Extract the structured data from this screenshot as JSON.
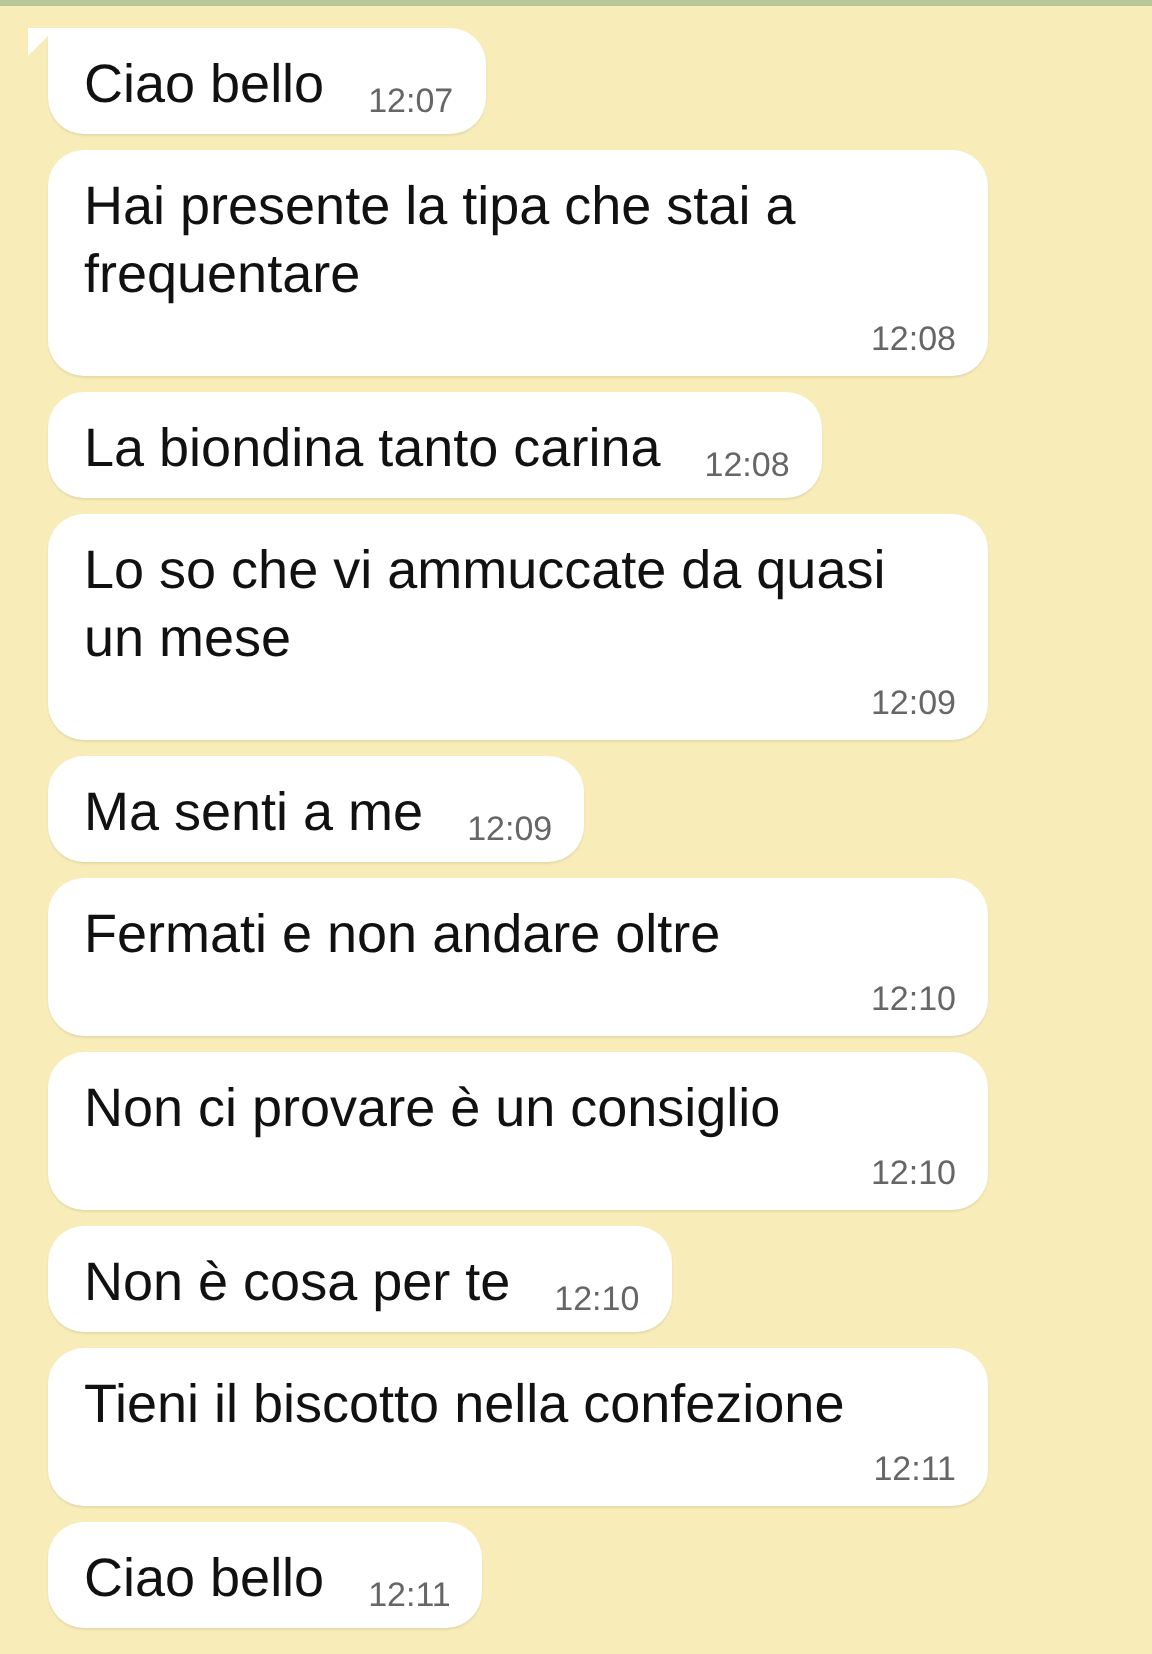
{
  "messages": [
    {
      "text": "Ciao bello",
      "time": "12:07",
      "kind": "inline",
      "tail": true
    },
    {
      "text": "Hai presente la tipa che stai a frequentare",
      "time": "12:08",
      "kind": "stacked",
      "tail": false
    },
    {
      "text": "La biondina tanto carina",
      "time": "12:08",
      "kind": "inline",
      "tail": false
    },
    {
      "text": "Lo so che vi ammuccate da quasi un mese",
      "time": "12:09",
      "kind": "stacked",
      "tail": false
    },
    {
      "text": "Ma senti a me",
      "time": "12:09",
      "kind": "inline",
      "tail": false
    },
    {
      "text": "Fermati e non andare oltre",
      "time": "12:10",
      "kind": "stacked",
      "tail": false
    },
    {
      "text": "Non ci provare è un consiglio",
      "time": "12:10",
      "kind": "stacked",
      "tail": false
    },
    {
      "text": "Non è cosa per te",
      "time": "12:10",
      "kind": "inline",
      "tail": false
    },
    {
      "text": "Tieni il biscotto nella confezione",
      "time": "12:11",
      "kind": "stacked",
      "tail": false
    },
    {
      "text": "Ciao bello",
      "time": "12:11",
      "kind": "inline",
      "tail": false
    }
  ]
}
